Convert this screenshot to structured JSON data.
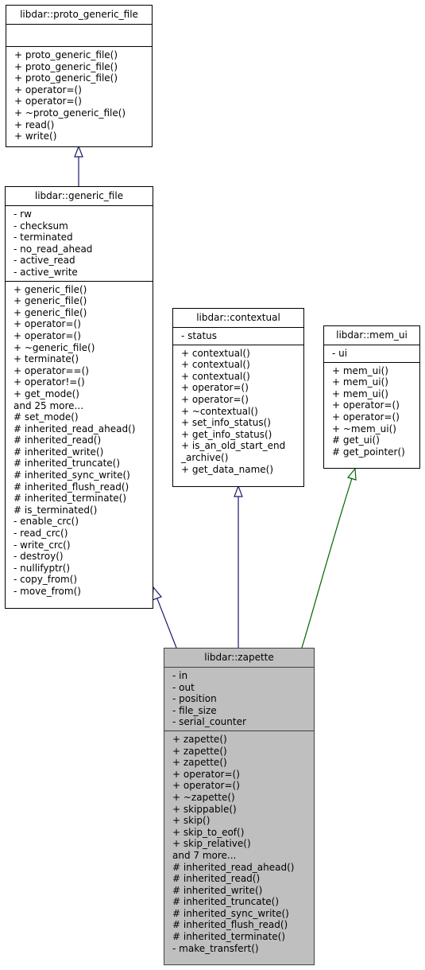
{
  "diagram": {
    "type": "class-inheritance",
    "classes": {
      "proto_generic_file": {
        "title": "libdar::proto_generic_file",
        "attributes": [],
        "methods": [
          "+ proto_generic_file()",
          "+ proto_generic_file()",
          "+ proto_generic_file()",
          "+ operator=()",
          "+ operator=()",
          "+ ~proto_generic_file()",
          "+ read()",
          "+ write()"
        ]
      },
      "generic_file": {
        "title": "libdar::generic_file",
        "attributes": [
          "- rw",
          "- checksum",
          "- terminated",
          "- no_read_ahead",
          "- active_read",
          "- active_write"
        ],
        "methods": [
          "+ generic_file()",
          "+ generic_file()",
          "+ generic_file()",
          "+ operator=()",
          "+ operator=()",
          "+ ~generic_file()",
          "+ terminate()",
          "+ operator==()",
          "+ operator!=()",
          "+ get_mode()",
          "and 25 more...",
          "# set_mode()",
          "# inherited_read_ahead()",
          "# inherited_read()",
          "# inherited_write()",
          "# inherited_truncate()",
          "# inherited_sync_write()",
          "# inherited_flush_read()",
          "# inherited_terminate()",
          "# is_terminated()",
          "- enable_crc()",
          "- read_crc()",
          "- write_crc()",
          "- destroy()",
          "- nullifyptr()",
          "- copy_from()",
          "- move_from()"
        ]
      },
      "contextual": {
        "title": "libdar::contextual",
        "attributes": [
          "- status"
        ],
        "methods": [
          "+ contextual()",
          "+ contextual()",
          "+ contextual()",
          "+ operator=()",
          "+ operator=()",
          "+ ~contextual()",
          "+ set_info_status()",
          "+ get_info_status()",
          "+ is_an_old_start_end",
          "_archive()",
          "+ get_data_name()"
        ]
      },
      "mem_ui": {
        "title": "libdar::mem_ui",
        "attributes": [
          "- ui"
        ],
        "methods": [
          "+ mem_ui()",
          "+ mem_ui()",
          "+ mem_ui()",
          "+ operator=()",
          "+ operator=()",
          "+ ~mem_ui()",
          "# get_ui()",
          "# get_pointer()"
        ]
      },
      "zapette": {
        "title": "libdar::zapette",
        "attributes": [
          "- in",
          "- out",
          "- position",
          "- file_size",
          "- serial_counter"
        ],
        "methods": [
          "+ zapette()",
          "+ zapette()",
          "+ zapette()",
          "+ operator=()",
          "+ operator=()",
          "+ ~zapette()",
          "+ skippable()",
          "+ skip()",
          "+ skip_to_eof()",
          "+ skip_relative()",
          "and 7 more...",
          "# inherited_read_ahead()",
          "# inherited_read()",
          "# inherited_write()",
          "# inherited_truncate()",
          "# inherited_sync_write()",
          "# inherited_flush_read()",
          "# inherited_terminate()",
          "- make_transfert()"
        ]
      }
    },
    "edges": [
      {
        "from": "generic_file",
        "to": "proto_generic_file",
        "kind": "public-inheritance",
        "color": "#191970"
      },
      {
        "from": "zapette",
        "to": "generic_file",
        "kind": "public-inheritance",
        "color": "#191970"
      },
      {
        "from": "zapette",
        "to": "contextual",
        "kind": "public-inheritance",
        "color": "#191970"
      },
      {
        "from": "zapette",
        "to": "mem_ui",
        "kind": "protected-inheritance",
        "color": "#006400"
      }
    ]
  }
}
